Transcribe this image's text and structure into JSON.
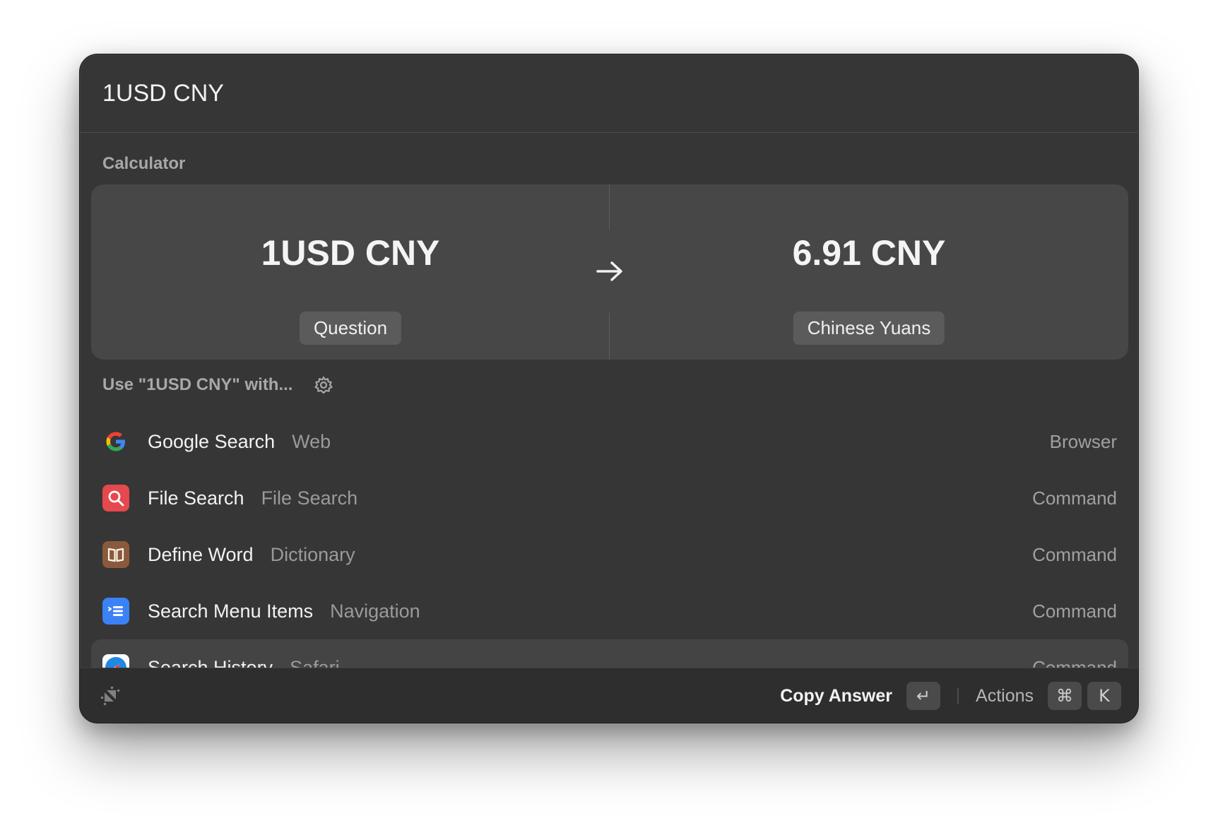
{
  "search": {
    "value": "1USD CNY"
  },
  "calculator": {
    "section_label": "Calculator",
    "question_value": "1USD CNY",
    "question_label": "Question",
    "answer_value": "6.91 CNY",
    "answer_label": "Chinese Yuans"
  },
  "use_with": {
    "label": "Use \"1USD CNY\" with..."
  },
  "results": [
    {
      "title": "Google Search",
      "subtitle": "Web",
      "type": "Browser",
      "icon": "google-icon"
    },
    {
      "title": "File Search",
      "subtitle": "File Search",
      "type": "Command",
      "icon": "magnifier-icon",
      "color": "#e5484d"
    },
    {
      "title": "Define Word",
      "subtitle": "Dictionary",
      "type": "Command",
      "icon": "book-icon",
      "color": "#8b5a3c"
    },
    {
      "title": "Search Menu Items",
      "subtitle": "Navigation",
      "type": "Command",
      "icon": "menu-list-icon",
      "color": "#3b82f6"
    },
    {
      "title": "Search History",
      "subtitle": "Safari",
      "type": "Command",
      "icon": "safari-compass-icon",
      "color": "#1e88e5"
    }
  ],
  "footer": {
    "primary_action": "Copy Answer",
    "primary_key": "↵",
    "secondary_action": "Actions",
    "secondary_key_1": "⌘",
    "secondary_key_2": "K"
  },
  "colors": {
    "window_bg": "#363636",
    "card_bg": "#474747",
    "footer_bg": "#2e2e2e"
  }
}
